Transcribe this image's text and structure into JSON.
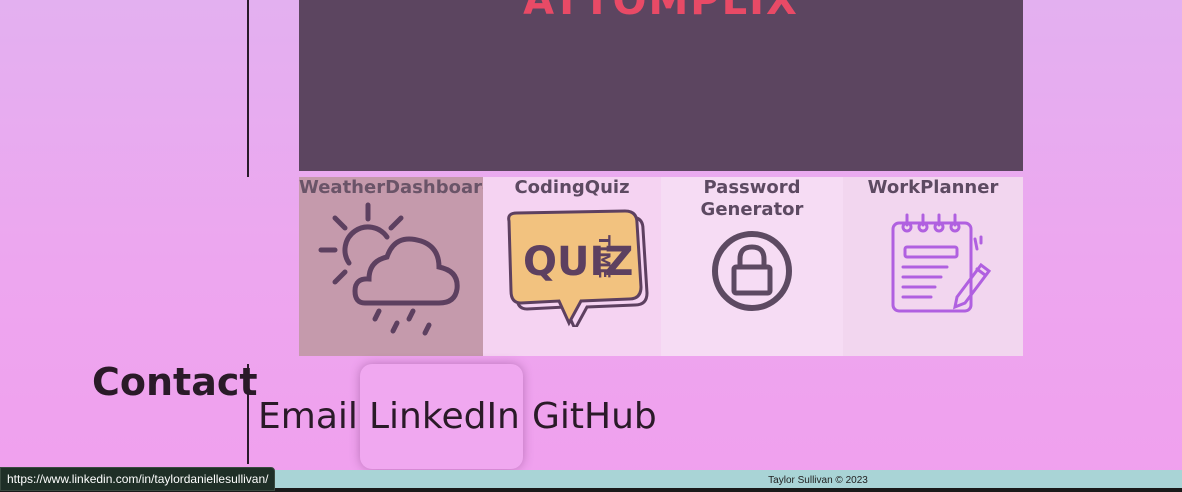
{
  "hero": {
    "title_fragment": "ATTOMPLIX"
  },
  "projects": [
    {
      "label": "WeatherDashboard",
      "icon": "weather-cloud-sun-icon"
    },
    {
      "label": "CodingQuiz",
      "icon": "quiz-time-icon",
      "icon_text": "QUIZ",
      "icon_subtext": "TIME"
    },
    {
      "label_line1": "Password",
      "label_line2": "Generator",
      "icon": "lock-icon"
    },
    {
      "label": "WorkPlanner",
      "icon": "notepad-pencil-icon"
    }
  ],
  "contact": {
    "title": "Contact",
    "links": {
      "email": "Email",
      "linkedin": "LinkedIn",
      "github": "GitHub"
    }
  },
  "footer": {
    "text": "Taylor Sullivan © 2023"
  },
  "status_bar": {
    "url": "https://www.linkedin.com/in/taylordaniellesullivan/"
  },
  "colors": {
    "background": "#e3b0f0",
    "hero_bg": "#5c4560",
    "hero_title": "#e84a66",
    "footer_bg": "#a9d4d6",
    "link_hover_bg": "#f0a8f0"
  }
}
